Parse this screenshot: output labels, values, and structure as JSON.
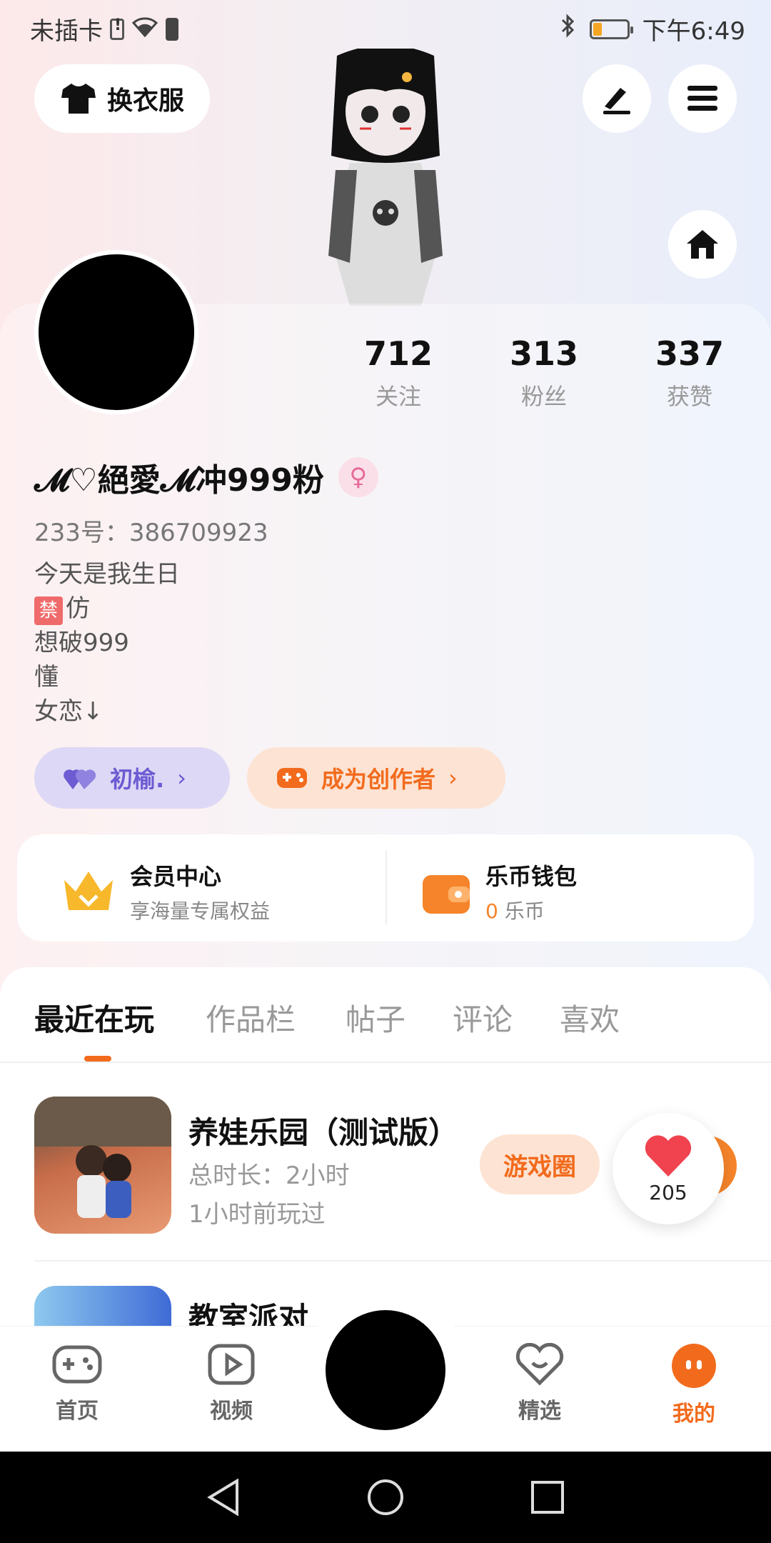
{
  "status_bar": {
    "carrier": "未插卡",
    "time": "下午6:49"
  },
  "header": {
    "outfit_label": "换衣服"
  },
  "profile": {
    "stats": [
      {
        "value": "712",
        "label": "关注"
      },
      {
        "value": "313",
        "label": "粉丝"
      },
      {
        "value": "337",
        "label": "获赞"
      }
    ],
    "nickname": "𝓜♡絕愛𝓜冲999粉",
    "uid": "233号：386709923",
    "bio": {
      "line1": "今天是我生日",
      "line2_badge": "禁",
      "line2": "仿",
      "line3": "想破999",
      "line4": "懂",
      "line5": "女恋↓"
    },
    "tag_label": "初榆.",
    "creator_label": "成为创作者"
  },
  "panel": {
    "member_title": "会员中心",
    "member_sub": "享海量专属权益",
    "wallet_title": "乐币钱包",
    "wallet_amount": "0",
    "wallet_unit": "乐币"
  },
  "tabs": [
    "最近在玩",
    "作品栏",
    "帖子",
    "评论",
    "喜欢"
  ],
  "games": [
    {
      "title": "养娃乐园（测试版）",
      "duration": "总时长：2小时",
      "last_played": "1小时前玩过",
      "circle_label": "游戏圈"
    },
    {
      "title": "教室派对"
    }
  ],
  "like_count": "205",
  "bottom_nav": {
    "home": "首页",
    "video": "视频",
    "featured": "精选",
    "mine": "我的"
  },
  "colors": {
    "accent": "#f26b1d",
    "purple": "#6c5bd2",
    "gold": "#f7b82b"
  }
}
